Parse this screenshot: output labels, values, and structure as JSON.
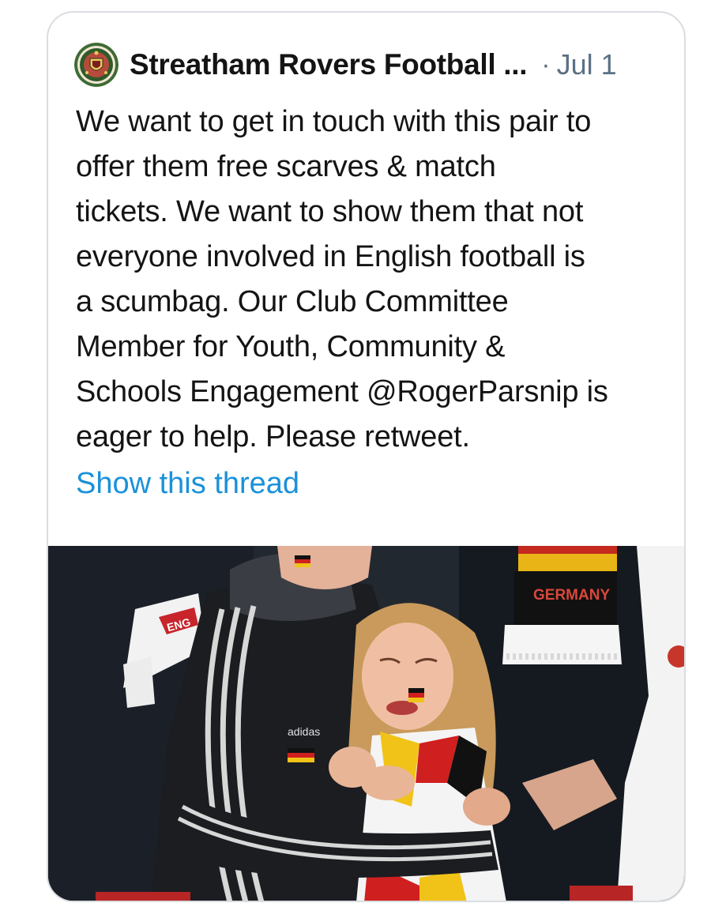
{
  "tweet": {
    "author_name": "Streatham Rovers Football ...",
    "separator": "·",
    "date": "Jul 1",
    "text": "We want to get in touch with this pair to\noffer them free scarves & match\ntickets. We want to show them that not\neveryone involved in English football is\na scumbag. Our Club Committee\nMember for Youth, Community &\nSchools Engagement @RogerParsnip is\neager to help. Please retweet.",
    "show_thread_label": "Show this thread"
  },
  "media": {
    "scarf_text": "GERMANY",
    "scarf_text_left": "ENG",
    "jacket_brand": "adidas"
  },
  "colors": {
    "link": "#1a91da",
    "meta_gray": "#5b7083",
    "card_border": "#d9dde1"
  },
  "icons": {
    "avatar": "club-crest-avatar"
  }
}
